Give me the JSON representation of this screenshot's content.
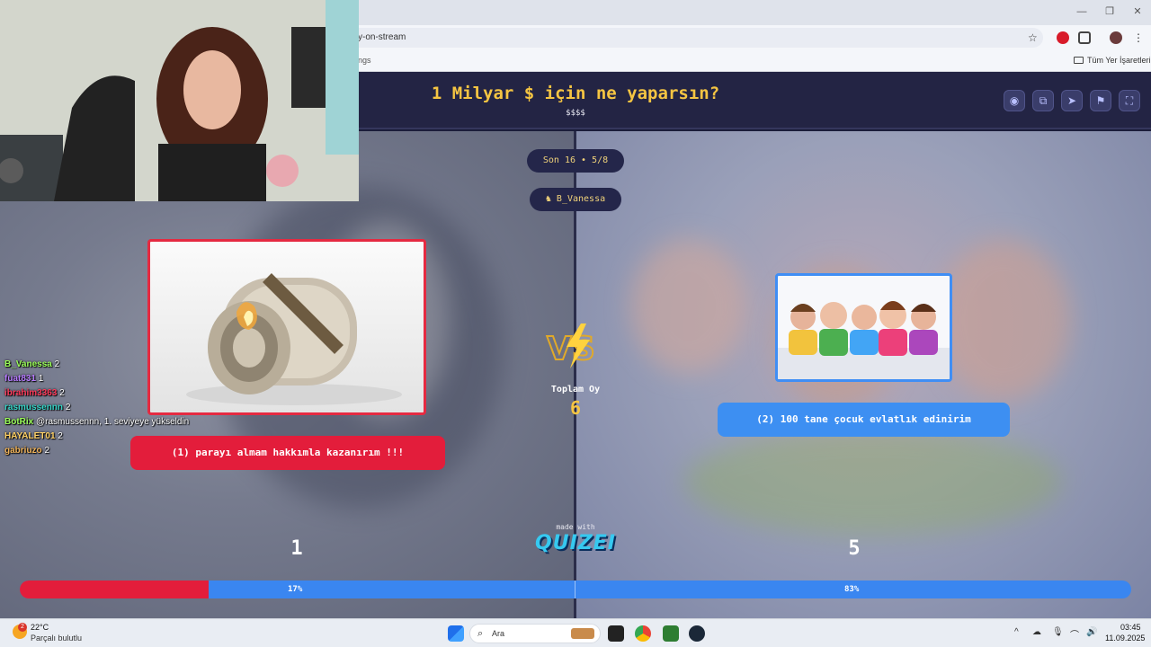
{
  "browser": {
    "url": "y-on-stream",
    "bookmarks_left": "ngs",
    "bookmarks_right": "Tüm Yer İşaretleri",
    "window_controls": [
      "—",
      "❐",
      "✕"
    ]
  },
  "header": {
    "question": "1 Milyar $ için ne yaparsın?",
    "subtitle": "$$$$",
    "buttons": [
      "eye-icon",
      "copy-icon",
      "send-icon",
      "flag-icon",
      "fullscreen-icon"
    ]
  },
  "round": {
    "stage": "Son 16 • 5/8",
    "player": "B_Vanessa"
  },
  "options": {
    "left": {
      "label": "(1) parayı almam hakkımla kazanırım !!!",
      "votes": "1",
      "percent": "17%",
      "share": 0.17,
      "color": "#e31d3b"
    },
    "right": {
      "label": "(2) 100 tane çocuk evlatlık edinirim",
      "votes": "5",
      "percent": "83%",
      "share": 0.83,
      "color": "#3d8ff2"
    }
  },
  "center": {
    "total_label": "Toplam Oy",
    "total_value": "6",
    "made_with": "made with",
    "brand": "QUIZEI"
  },
  "chat": [
    {
      "user": "B_Vanessa",
      "msg": "2",
      "color": "#9bff5a"
    },
    {
      "user": "fuat831",
      "msg": "1",
      "color": "#b77cff"
    },
    {
      "user": "ibrahim3363",
      "msg": "2",
      "color": "#ff3b5c"
    },
    {
      "user": "rasmussennn",
      "msg": "2",
      "color": "#35d4c7"
    },
    {
      "user": "BotRix",
      "msg": "@rasmussennn, 1. seviyeye yükseldin",
      "color": "#9bff5a"
    },
    {
      "user": "HAYALET01",
      "msg": "2",
      "color": "#ffd166"
    },
    {
      "user": "gabriuzo",
      "msg": "2",
      "color": "#f0b35a"
    }
  ],
  "taskbar": {
    "weather_temp": "22°C",
    "weather_desc": "Parçalı bulutlu",
    "weather_badge": "2",
    "search_placeholder": "Ara",
    "time": "03:45",
    "date": "11.09.2025"
  }
}
